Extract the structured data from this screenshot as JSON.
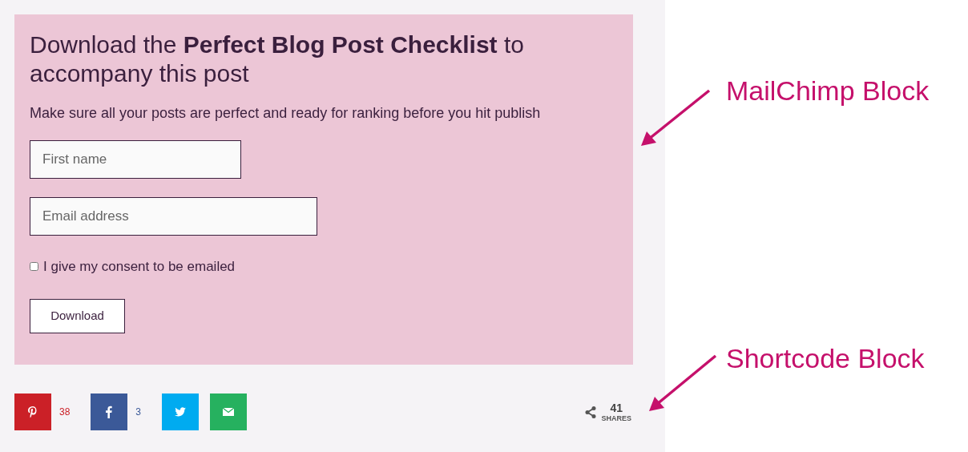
{
  "signup": {
    "heading": "Download the **Perfect Blog Post Checklist** to accompany this post",
    "subheading": "Make sure all your posts are perfect and ready for ranking before you hit publish",
    "fields": [
      {
        "placeholder": "First name"
      },
      {
        "placeholder": "Email address"
      }
    ],
    "consent": {
      "label": "I give my consent to be emailed",
      "checked": false
    },
    "button": "Download"
  },
  "share_bar": {
    "buttons": [
      {
        "kind": "pinterest",
        "count": "38"
      },
      {
        "kind": "facebook",
        "count": "3"
      },
      {
        "kind": "twitter"
      },
      {
        "kind": "email"
      }
    ],
    "total": "41",
    "total_label": "SHARES"
  },
  "annotations": [
    {
      "label": "MailChimp Block"
    },
    {
      "label": "Shortcode Block"
    }
  ]
}
